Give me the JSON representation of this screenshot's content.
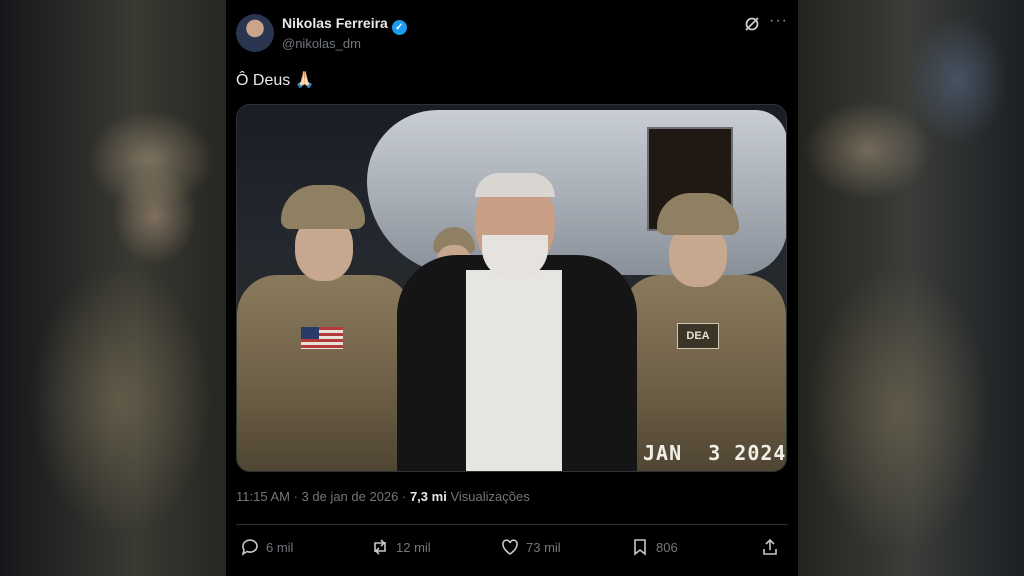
{
  "post": {
    "author_name": "Nikolas Ferreira",
    "author_handle": "@nikolas_dm",
    "text": "Ô Deus 🙏🏻",
    "media": {
      "patch_label": "DEA",
      "date_stamp": "JAN  3 2024"
    },
    "meta": {
      "time": "11:15 AM · 3 de jan de 2026 ·",
      "views_count": "7,3 mi",
      "views_label": "Visualizações"
    },
    "actions": {
      "replies": "6 mil",
      "reposts": "12 mil",
      "likes": "73 mil",
      "bookmarks": "806"
    }
  },
  "colors": {
    "background": "#000000",
    "text": "#e7e9ea",
    "muted": "#71767b",
    "verified": "#1d9bf0"
  }
}
